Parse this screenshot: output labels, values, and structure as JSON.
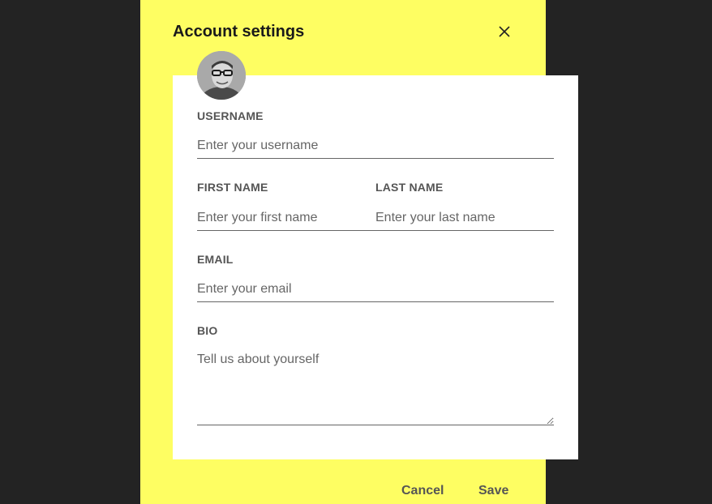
{
  "dialog": {
    "title": "Account settings",
    "close_icon": "close-icon",
    "avatar_icon": "user-avatar"
  },
  "form": {
    "username": {
      "label": "USERNAME",
      "placeholder": "Enter your username"
    },
    "first_name": {
      "label": "FIRST NAME",
      "placeholder": "Enter your first name"
    },
    "last_name": {
      "label": "LAST NAME",
      "placeholder": "Enter your last name"
    },
    "email": {
      "label": "EMAIL",
      "placeholder": "Enter your email"
    },
    "bio": {
      "label": "BIO",
      "placeholder": "Tell us about yourself"
    }
  },
  "footer": {
    "cancel_label": "Cancel",
    "save_label": "Save"
  },
  "colors": {
    "backdrop": "#232323",
    "dialog_bg": "#fefe62",
    "card_bg": "#ffffff",
    "label": "#555555"
  }
}
